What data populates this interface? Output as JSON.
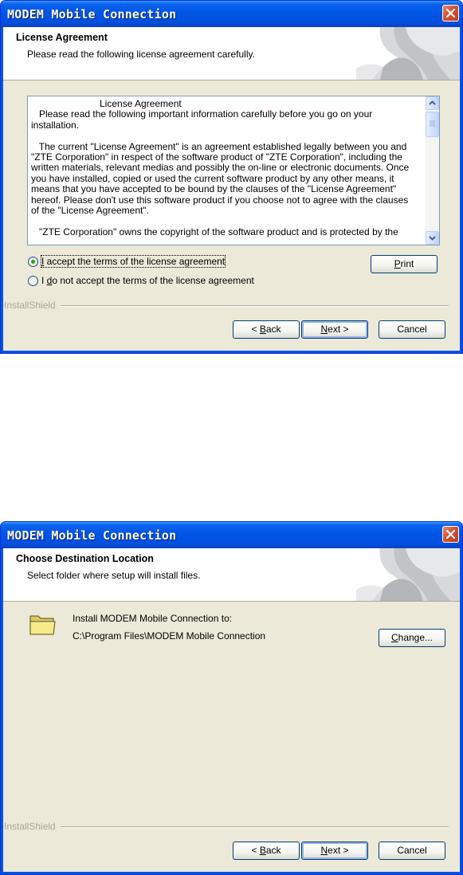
{
  "dialog1": {
    "title": "MODEM Mobile Connection",
    "header_title": "License Agreement",
    "header_subtitle": "Please read the following license agreement carefully.",
    "license_text": {
      "heading": "License Agreement",
      "line1": "   Please read the following important information carefully before you go on your",
      "line2": "installation.",
      "para": [
        "   The current \"License Agreement\" is an agreement established legally between you and",
        "\"ZTE Corporation\" in respect of the software product of \"ZTE Corporation\", including the",
        "written materials, relevant medias and possibly the on-line or electronic documents. Once",
        "you have installed, copied or used the current software product by any other means, it",
        "means that you have accepted to be bound by the clauses of the \"License Agreement\"",
        "hereof. Please don't use this software product if you choose not to agree with the clauses",
        "of the \"License Agreement\"."
      ],
      "cut_line": "   \"ZTE Corporation\" owns the copyright of the software product and is protected by the"
    },
    "accept_option": {
      "prefix": "",
      "mnemonic": "I",
      "rest": " accept the terms of the license agreement",
      "selected": true
    },
    "decline_option": {
      "prefix": "I ",
      "mnemonic": "d",
      "rest": "o not accept the terms of the license agreement",
      "selected": false
    },
    "print_button": {
      "mnemonic": "P",
      "rest": "rint"
    },
    "installshield_label": "InstallShield",
    "back_button": {
      "prefix": "< ",
      "mnemonic": "B",
      "rest": "ack"
    },
    "next_button": {
      "mnemonic": "N",
      "rest": "ext >"
    },
    "cancel_button": "Cancel"
  },
  "dialog2": {
    "title": "MODEM Mobile Connection",
    "header_title": "Choose Destination Location",
    "header_subtitle": "Select folder where setup will install files.",
    "install_label": "Install MODEM Mobile Connection to:",
    "install_path": "C:\\Program Files\\MODEM Mobile Connection",
    "change_button": {
      "mnemonic": "C",
      "rest": "hange..."
    },
    "installshield_label": "InstallShield",
    "back_button": {
      "prefix": "< ",
      "mnemonic": "B",
      "rest": "ack"
    },
    "next_button": {
      "mnemonic": "N",
      "rest": "ext >"
    },
    "cancel_button": "Cancel"
  },
  "colors": {
    "title_bar": "#0a53e0",
    "dialog_bg": "#ece9d8",
    "close_button": "#d6502f",
    "radio_selected": "#21a121"
  }
}
